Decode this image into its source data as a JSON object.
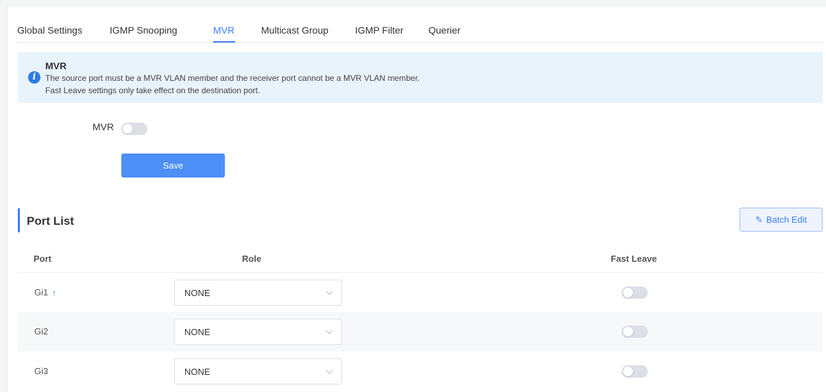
{
  "tabs": [
    {
      "label": "Global Settings",
      "active": false
    },
    {
      "label": "IGMP Snooping",
      "active": false
    },
    {
      "label": "MVR",
      "active": true
    },
    {
      "label": "Multicast Group",
      "active": false
    },
    {
      "label": "IGMP Filter",
      "active": false
    },
    {
      "label": "Querier",
      "active": false
    }
  ],
  "info": {
    "icon": "info-icon",
    "title": "MVR",
    "lines": [
      "The source port must be a MVR VLAN member and the receiver port cannot be a MVR VLAN member.",
      "Fast Leave settings only take effect on the destination port."
    ]
  },
  "mvr": {
    "label": "MVR",
    "enabled": false,
    "save_label": "Save"
  },
  "port_list": {
    "title": "Port List",
    "batch_edit_label": "Batch Edit",
    "columns": {
      "port": "Port",
      "role": "Role",
      "fast_leave": "Fast Leave"
    },
    "rows": [
      {
        "port": "Gi1",
        "uplink": true,
        "uplink_icon": "↑",
        "role": "NONE",
        "fast_leave": false
      },
      {
        "port": "Gi2",
        "uplink": false,
        "role": "NONE",
        "fast_leave": false
      },
      {
        "port": "Gi3",
        "uplink": false,
        "role": "NONE",
        "fast_leave": false
      }
    ]
  },
  "colors": {
    "accent": "#3e7ef7",
    "info_bg": "#e8f3fc",
    "button": "#4d8ff7"
  }
}
